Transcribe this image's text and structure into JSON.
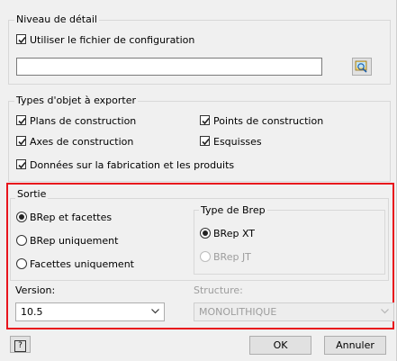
{
  "detail_group": {
    "title": "Niveau de détail",
    "use_config_label": "Utiliser le fichier de configuration",
    "use_config_checked": true,
    "path_value": ""
  },
  "object_types": {
    "title": "Types d'objet à exporter",
    "items": [
      {
        "label": "Plans de construction",
        "checked": true
      },
      {
        "label": "Points de construction",
        "checked": true
      },
      {
        "label": "Axes de construction",
        "checked": true
      },
      {
        "label": "Esquisses",
        "checked": true
      },
      {
        "label": "Données sur la fabrication et les produits",
        "checked": true
      }
    ]
  },
  "output": {
    "title": "Sortie",
    "radios": [
      {
        "label": "BRep et facettes",
        "selected": true
      },
      {
        "label": "BRep uniquement",
        "selected": false
      },
      {
        "label": "Facettes uniquement",
        "selected": false
      }
    ],
    "brep_type": {
      "title": "Type de Brep",
      "options": [
        {
          "label": "BRep XT",
          "selected": true,
          "enabled": true
        },
        {
          "label": "BRep JT",
          "selected": false,
          "enabled": false
        }
      ]
    },
    "version_label": "Version:",
    "version_value": "10.5",
    "structure_label": "Structure:",
    "structure_value": "MONOLITHIQUE"
  },
  "buttons": {
    "help": "?",
    "ok": "OK",
    "cancel": "Annuler"
  },
  "colors": {
    "highlight": "#e8141c",
    "window": "#f0f0f0"
  }
}
